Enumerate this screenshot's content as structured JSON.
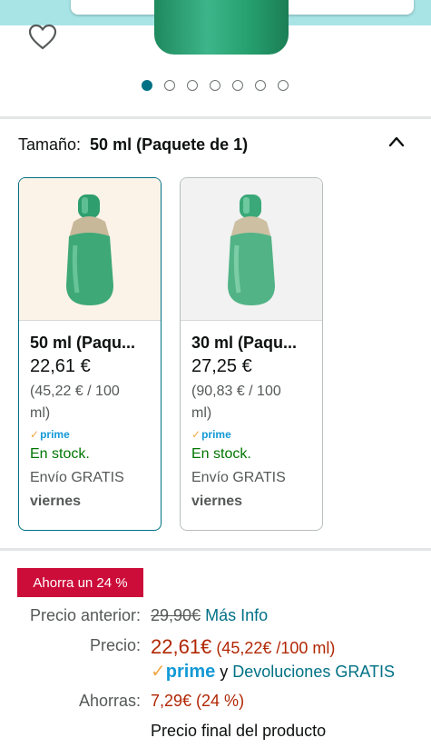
{
  "gallery": {
    "total_images": 7,
    "active_index": 0
  },
  "size_selector": {
    "label": "Tamaño:",
    "selected": "50 ml (Paquete de 1)"
  },
  "options": [
    {
      "name": "50 ml (Paqu...",
      "price": "22,61 €",
      "unit_price_line1": "(45,22 € / 100",
      "unit_price_line2": "ml)",
      "prime": "prime",
      "stock": "En stock.",
      "shipping": "Envío GRATIS",
      "delivery_day": "viernes",
      "selected": true
    },
    {
      "name": "30 ml (Paqu...",
      "price": "27,25 €",
      "unit_price_line1": "(90,83 € / 100",
      "unit_price_line2": "ml)",
      "prime": "prime",
      "stock": "En stock.",
      "shipping": "Envío GRATIS",
      "delivery_day": "viernes",
      "selected": false
    }
  ],
  "pricing": {
    "badge": "Ahorra un 24 %",
    "previous_label": "Precio anterior:",
    "previous_value": "29,90€",
    "more_info": "Más Info",
    "price_label": "Precio:",
    "price_value": "22,61€",
    "price_unit": "(45,22€ /100 ml)",
    "prime": "prime",
    "and": "y",
    "returns": "Devoluciones GRATIS",
    "savings_label": "Ahorras:",
    "savings_value": "7,29€ (24 %)",
    "final_note": "Precio final del producto"
  },
  "colors": {
    "accent": "#007185",
    "deal_red": "#cc0c39",
    "price_red": "#b12704",
    "stock_green": "#007600",
    "prime_blue": "#1399d6"
  }
}
